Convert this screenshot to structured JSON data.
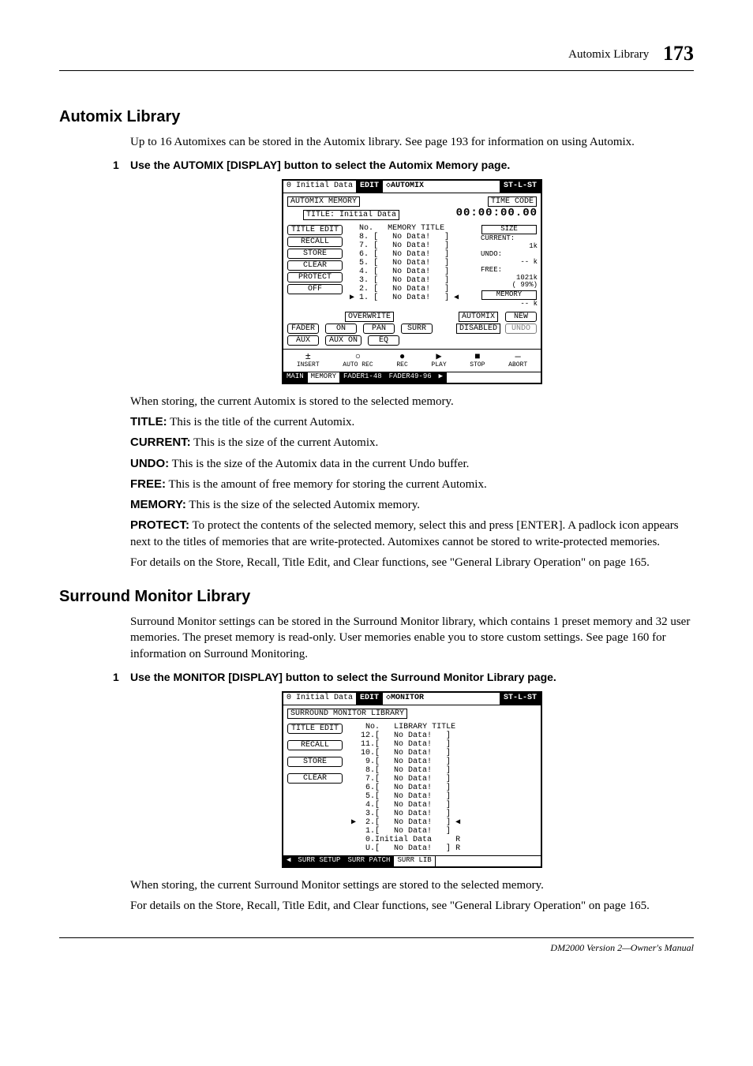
{
  "header": {
    "section_label": "Automix Library",
    "page_number": "173"
  },
  "section1": {
    "heading": "Automix Library",
    "intro": "Up to 16 Automixes can be stored in the Automix library. See page 193 for information on using Automix.",
    "step_num": "1",
    "step_text": "Use the AUTOMIX [DISPLAY] button to select the Automix Memory page.",
    "after_fig": "When storing, the current Automix is stored to the selected memory.",
    "defs": {
      "title_t": "TITLE:",
      "title_d": " This is the title of the current Automix.",
      "current_t": "CURRENT:",
      "current_d": " This is the size of the current Automix.",
      "undo_t": "UNDO:",
      "undo_d": " This is the size of the Automix data in the current Undo buffer.",
      "free_t": "FREE:",
      "free_d": " This is the amount of free memory for storing the current Automix.",
      "memory_t": "MEMORY:",
      "memory_d": " This is the size of the selected Automix memory.",
      "protect_t": "PROTECT:",
      "protect_d": " To protect the contents of the selected memory, select this and press [ENTER]. A padlock icon appears next to the titles of memories that are write-protected. Automixes cannot be stored to write-protected memories."
    },
    "closing": "For details on the Store, Recall, Title Edit, and Clear functions, see \"General Library Operation\" on page 165."
  },
  "section2": {
    "heading": "Surround Monitor Library",
    "intro": "Surround Monitor settings can be stored in the Surround Monitor library, which contains 1 preset memory and 32 user memories. The preset memory is read-only. User memories enable you to store custom settings. See page 160 for information on Surround Monitoring.",
    "step_num": "1",
    "step_text": "Use the MONITOR [DISPLAY] button to select the Surround Monitor Library page.",
    "after_fig": "When storing, the current Surround Monitor settings are stored to the selected memory.",
    "closing": "For details on the Store, Recall, Title Edit, and Clear functions, see \"General Library Operation\" on page 165."
  },
  "automix_screen": {
    "title_left": "0 Initial Data",
    "edit_badge": "EDIT",
    "title_mid": "◇AUTOMIX",
    "title_right": "ST-L-ST",
    "box_memory": "AUTOMIX MEMORY",
    "title_field_label": "TITLE:",
    "title_field_value": "Initial Data",
    "timecode_label": "TIME CODE",
    "timecode_value": "00:00:00.00",
    "col_no": "No.",
    "col_title": "MEMORY TITLE",
    "side_buttons": [
      "TITLE EDIT",
      "RECALL",
      "STORE",
      "CLEAR",
      "PROTECT",
      "OFF"
    ],
    "list": [
      {
        "n": "8.",
        "t": "[   No Data!   ]"
      },
      {
        "n": "7.",
        "t": "[   No Data!   ]"
      },
      {
        "n": "6.",
        "t": "[   No Data!   ]"
      },
      {
        "n": "5.",
        "t": "[   No Data!   ]"
      },
      {
        "n": "4.",
        "t": "[   No Data!   ]"
      },
      {
        "n": "3.",
        "t": "[   No Data!   ]"
      },
      {
        "n": "2.",
        "t": "[   No Data!   ]"
      },
      {
        "n": "1.",
        "t": "[   No Data!   ]"
      }
    ],
    "size_label": "SIZE",
    "current_label": "CURRENT:",
    "current_val": "1k",
    "undo_label": "UNDO:",
    "undo_val": "-- k",
    "free_label": "FREE:",
    "free_val1": "1021k",
    "free_val2": "( 99%)",
    "memory_label": "MEMORY",
    "memory_val": "-- k",
    "overwrite": "OVERWRITE",
    "ow_btns_row1": [
      "FADER",
      "ON",
      "PAN",
      "SURR"
    ],
    "ow_btns_row2": [
      "AUX",
      "AUX ON",
      "EQ"
    ],
    "automix_box_label": "AUTOMIX",
    "disabled": "DISABLED",
    "new_btn": "NEW",
    "undo_btn": "UNDO",
    "transport": [
      {
        "s": "±",
        "l": "INSERT"
      },
      {
        "s": "○",
        "l": "AUTO REC"
      },
      {
        "s": "●",
        "l": "REC"
      },
      {
        "s": "▶",
        "l": "PLAY"
      },
      {
        "s": "■",
        "l": "STOP"
      },
      {
        "s": "—",
        "l": "ABORT"
      }
    ],
    "tabs": [
      "MAIN",
      "MEMORY",
      "FADER1-48",
      "FADER49-96",
      "▶"
    ]
  },
  "monitor_screen": {
    "title_left": "0 Initial Data",
    "edit_badge": "EDIT",
    "title_mid": "◇MONITOR",
    "title_right": "ST-L-ST",
    "box_label": "SURROUND MONITOR LIBRARY",
    "col_no": "No.",
    "col_title": "LIBRARY TITLE",
    "side_buttons": [
      "TITLE EDIT",
      "RECALL",
      "STORE",
      "CLEAR"
    ],
    "list": [
      {
        "n": "12.",
        "t": "[   No Data!   ]"
      },
      {
        "n": "11.",
        "t": "[   No Data!   ]"
      },
      {
        "n": "10.",
        "t": "[   No Data!   ]"
      },
      {
        "n": " 9.",
        "t": "[   No Data!   ]"
      },
      {
        "n": " 8.",
        "t": "[   No Data!   ]"
      },
      {
        "n": " 7.",
        "t": "[   No Data!   ]"
      },
      {
        "n": " 6.",
        "t": "[   No Data!   ]"
      },
      {
        "n": " 5.",
        "t": "[   No Data!   ]"
      },
      {
        "n": " 4.",
        "t": "[   No Data!   ]"
      },
      {
        "n": " 3.",
        "t": "[   No Data!   ]"
      },
      {
        "n": " 2.",
        "t": "[   No Data!   ]"
      },
      {
        "n": " 1.",
        "t": "[   No Data!   ]"
      },
      {
        "n": " 0.",
        "t": "Initial Data     R"
      },
      {
        "n": " U.",
        "t": "[   No Data!   ] R"
      }
    ],
    "tabs": [
      "◀",
      "SURR SETUP",
      "SURR PATCH",
      "SURR LIB"
    ]
  },
  "footer": "DM2000 Version 2—Owner's Manual"
}
